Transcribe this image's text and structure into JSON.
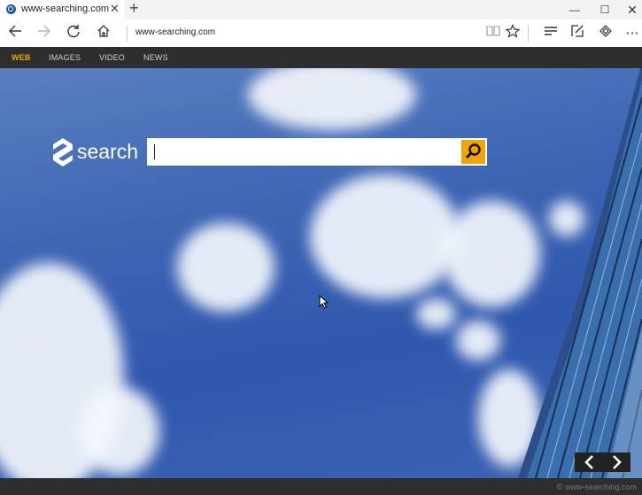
{
  "browser": {
    "tab_title": "www-searching.com",
    "new_tab_glyph": "+",
    "url": "www-searching.com",
    "icons": [
      "back-icon",
      "forward-icon",
      "refresh-icon",
      "home-icon",
      "reading-view-icon",
      "favorite-star-icon",
      "hub-icon",
      "web-note-icon",
      "share-icon",
      "more-icon"
    ]
  },
  "site_nav": {
    "items": [
      {
        "label": "WEB",
        "active": true
      },
      {
        "label": "IMAGES",
        "active": false
      },
      {
        "label": "VIDEO",
        "active": false
      },
      {
        "label": "NEWS",
        "active": false
      }
    ]
  },
  "hero": {
    "logo_text": "search",
    "search": {
      "value": "",
      "placeholder": ""
    }
  },
  "footer": {
    "copyright": "© www-searching.com"
  },
  "colors": {
    "accent": "#f0a400",
    "nav_bg": "#2e2e2e",
    "sky": "#3e66b4"
  }
}
